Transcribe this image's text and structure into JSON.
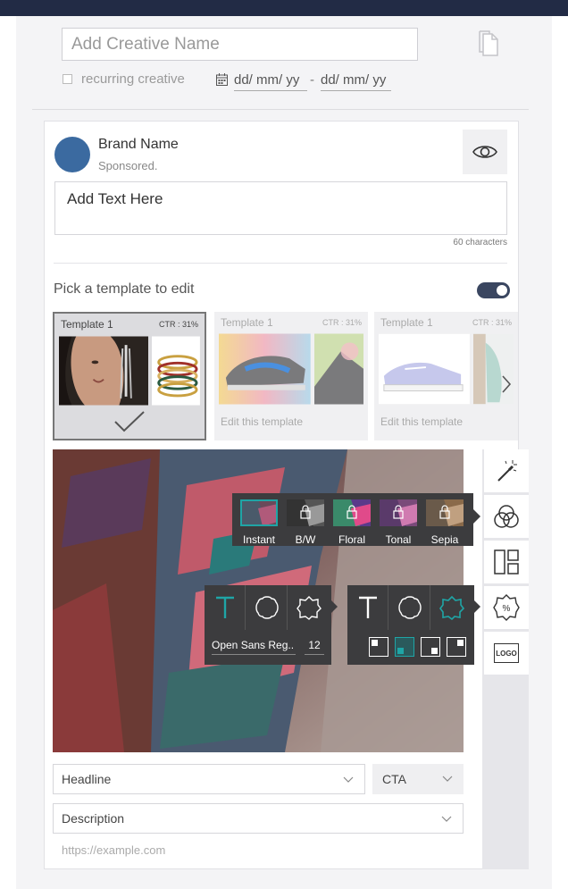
{
  "header": {
    "creative_name_placeholder": "Add Creative Name",
    "recurring_label": "recurring creative",
    "date_start": "dd/ mm/ yy",
    "date_separator": "-",
    "date_end": "dd/ mm/ yy"
  },
  "post": {
    "brand_name": "Brand Name",
    "sponsored": "Sponsored.",
    "text_placeholder": "Add Text Here",
    "char_count": "60 characters"
  },
  "templates": {
    "heading": "Pick a template to edit",
    "toggle_on": true,
    "items": [
      {
        "name": "Template 1",
        "ctr": "CTR : 31%",
        "footer": "",
        "selected": true
      },
      {
        "name": "Template 1",
        "ctr": "CTR : 31%",
        "footer": "Edit this template",
        "selected": false
      },
      {
        "name": "Template 1",
        "ctr": "CTR : 31%",
        "footer": "Edit this template",
        "selected": false
      }
    ]
  },
  "filters": {
    "items": [
      {
        "label": "Instant",
        "locked": false,
        "selected": true
      },
      {
        "label": "B/W",
        "locked": true,
        "selected": false
      },
      {
        "label": "Floral",
        "locked": true,
        "selected": false
      },
      {
        "label": "Tonal",
        "locked": true,
        "selected": false
      },
      {
        "label": "Sepia",
        "locked": true,
        "selected": false
      }
    ]
  },
  "text_tool": {
    "font": "Open Sans Reg..",
    "size": "12"
  },
  "rail": {
    "logo_label": "LOGO"
  },
  "fields": {
    "headline": "Headline",
    "cta": "CTA",
    "description": "Description",
    "url_placeholder": "https://example.com"
  },
  "colors": {
    "accent_teal": "#1fa5a6",
    "topbar": "#222b45",
    "avatar": "#3b6aa0",
    "popover": "#3c3c3e"
  }
}
